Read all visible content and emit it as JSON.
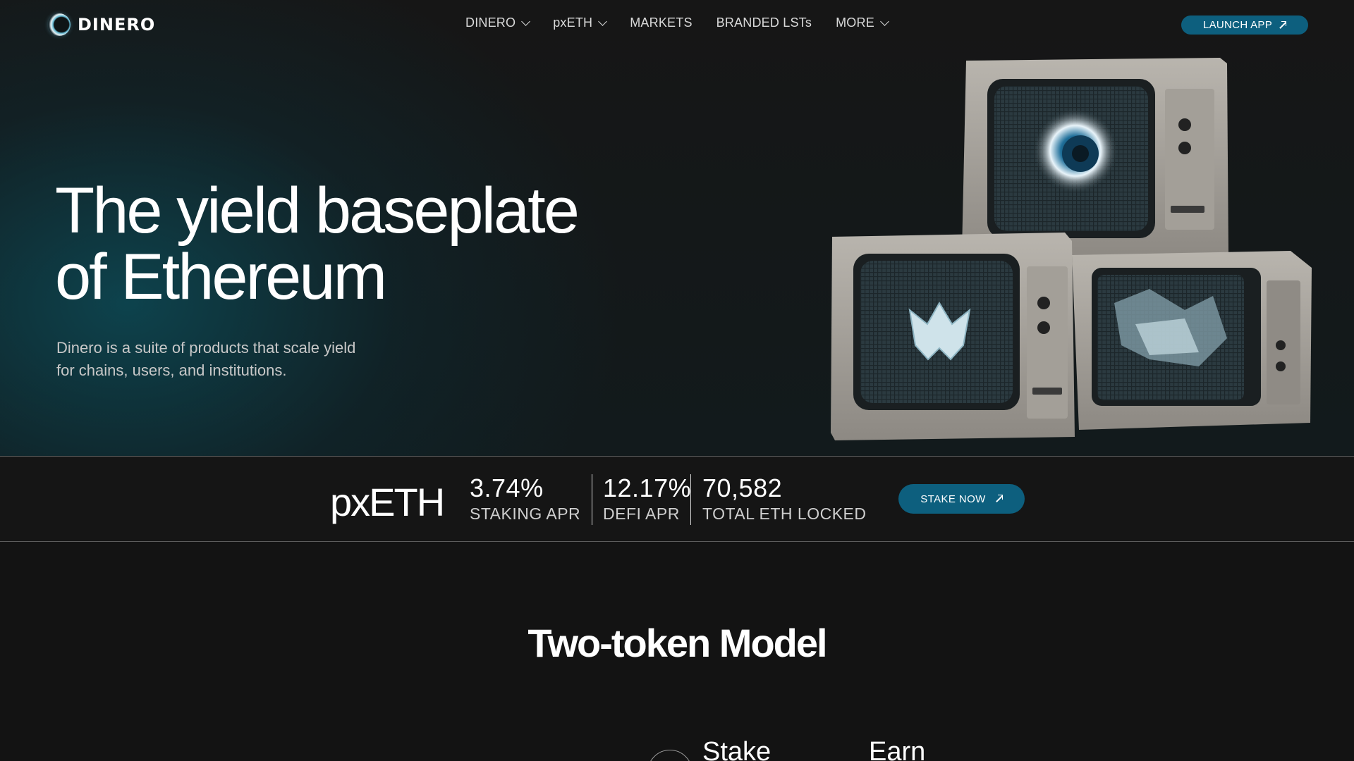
{
  "nav": {
    "logo_text": "DINERO",
    "items": [
      {
        "label": "DINERO",
        "dropdown": true
      },
      {
        "label": "pxETH",
        "dropdown": true
      },
      {
        "label": "MARKETS",
        "dropdown": false
      },
      {
        "label": "BRANDED LSTs",
        "dropdown": false
      },
      {
        "label": "MORE",
        "dropdown": true
      }
    ],
    "launch_label": "LAUNCH APP"
  },
  "hero": {
    "headline_line1": "The yield baseplate",
    "headline_line2": "of Ethereum",
    "subtext": "Dinero is a suite of products that scale yield for chains, users, and institutions."
  },
  "stats": {
    "token": "pxETH",
    "items": [
      {
        "value": "3.74%",
        "label": "STAKING APR"
      },
      {
        "value": "12.17%",
        "label": "DEFI APR"
      },
      {
        "value": "70,582",
        "label": "TOTAL ETH LOCKED"
      }
    ],
    "cta_label": "STAKE NOW"
  },
  "section": {
    "title": "Two-token Model",
    "columns": [
      "Stake",
      "Earn"
    ]
  },
  "colors": {
    "background": "#131313",
    "accent": "#0d5f7e",
    "hero_glow": "#0c4a56"
  },
  "icons": [
    "dinero-logo-icon",
    "chevron-down-icon",
    "arrow-up-right-icon",
    "retro-tv-illustration"
  ]
}
